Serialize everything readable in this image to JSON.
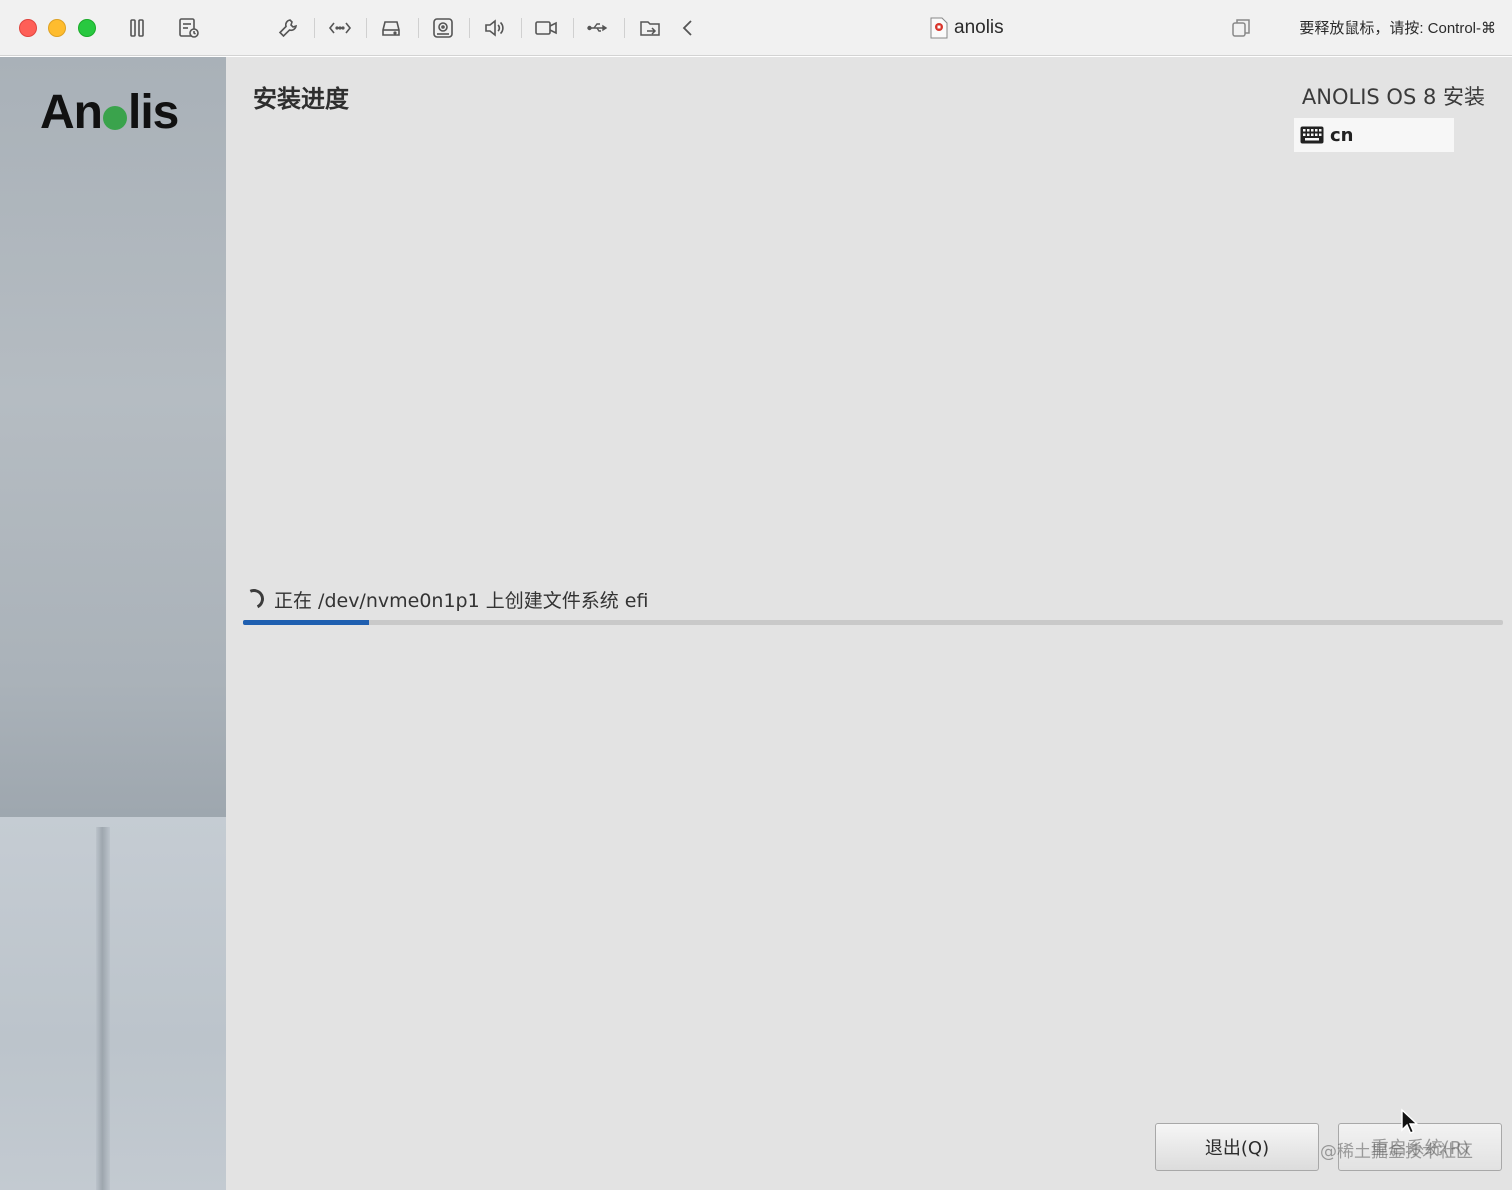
{
  "window": {
    "title": "anolis",
    "release_hint": "要释放鼠标，请按: Control-⌘"
  },
  "toolbar": {
    "icons": [
      "pause-icon",
      "snapshot-icon",
      "settings-wrench-icon",
      "network-icon",
      "disk-icon",
      "cdrom-icon",
      "sound-icon",
      "camera-icon",
      "usb-icon",
      "shared-folder-icon",
      "collapse-chevron-icon",
      "window-restore-icon"
    ]
  },
  "sidebar": {
    "logo_text_left": "An",
    "logo_text_right": "lis"
  },
  "header": {
    "page_title": "安装进度",
    "product_title": "ANOLIS OS 8 安装",
    "keyboard_layout": "cn"
  },
  "progress": {
    "status_text": "正在 /dev/nvme0n1p1 上创建文件系统 efi",
    "fraction": 0.1
  },
  "footer": {
    "quit_label": "退出(Q)",
    "reboot_label": "重启系统(R)"
  },
  "watermark": "@稀土掘金技术社区",
  "colors": {
    "accent": "#1f5fb0",
    "logo_green": "#3aa34c"
  }
}
